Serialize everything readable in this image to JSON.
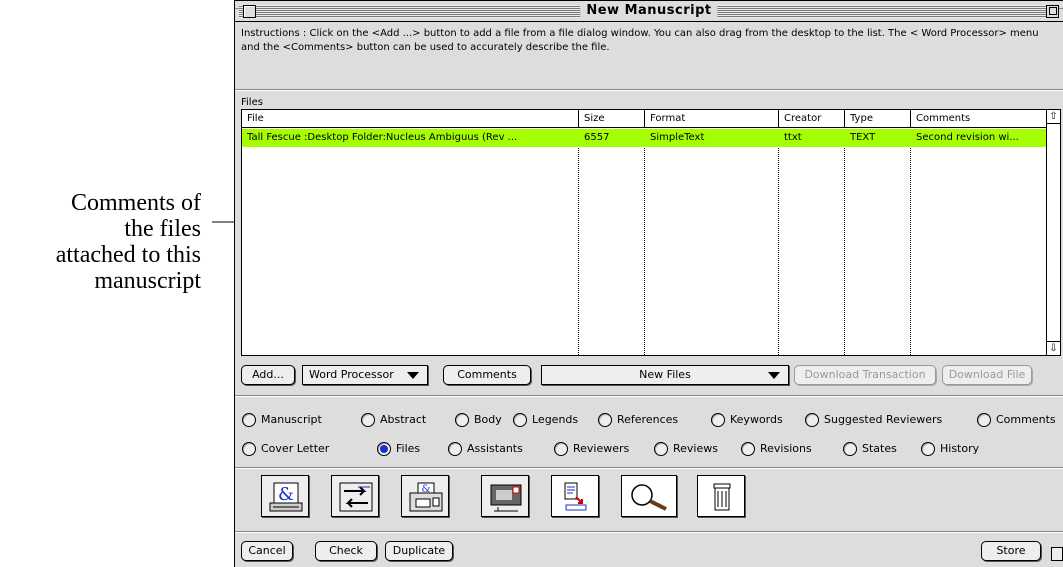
{
  "annotation": {
    "text": "Comments of\nthe files\nattached to this\nmanuscript"
  },
  "window": {
    "title": "New Manuscript"
  },
  "instructions": "Instructions : Click on the <Add ...> button to add a file from a file dialog window.  You can also drag from the desktop to the list.  The < Word Processor> menu and the <Comments> button can be used to accurately describe the file.",
  "files_label": "Files",
  "table": {
    "headers": [
      "File",
      "Size",
      "Format",
      "Creator",
      "Type",
      "Comments"
    ],
    "rows": [
      {
        "file": "Tall Fescue :Desktop Folder:Nucleus Ambiguus (Rev ...",
        "size": "6557",
        "format": "SimpleText",
        "creator": "ttxt",
        "type": "TEXT",
        "comments": "Second revision wi..."
      }
    ],
    "selected_row_color": "#a6ff00"
  },
  "actions": {
    "add": "Add...",
    "word_processor": "Word Processor",
    "comments": "Comments",
    "new_files": "New Files",
    "download_transaction": "Download Transaction",
    "download_file": "Download File"
  },
  "sections_row1": [
    "Manuscript",
    "Abstract",
    "Body",
    "Legends",
    "References",
    "Keywords",
    "Suggested Reviewers",
    "Comments"
  ],
  "sections_row2": [
    "Cover Letter",
    "Files",
    "Assistants",
    "Reviewers",
    "Reviews",
    "Revisions",
    "States",
    "History"
  ],
  "selected_section": "Files",
  "tools": [
    "word-processor-icon",
    "transfer-icon",
    "printer-icon",
    "mail-icon",
    "document-download-icon",
    "magnifier-icon",
    "trash-icon"
  ],
  "footer": {
    "cancel": "Cancel",
    "check": "Check",
    "duplicate": "Duplicate",
    "store": "Store"
  },
  "accent_color": "#1a2fd0"
}
